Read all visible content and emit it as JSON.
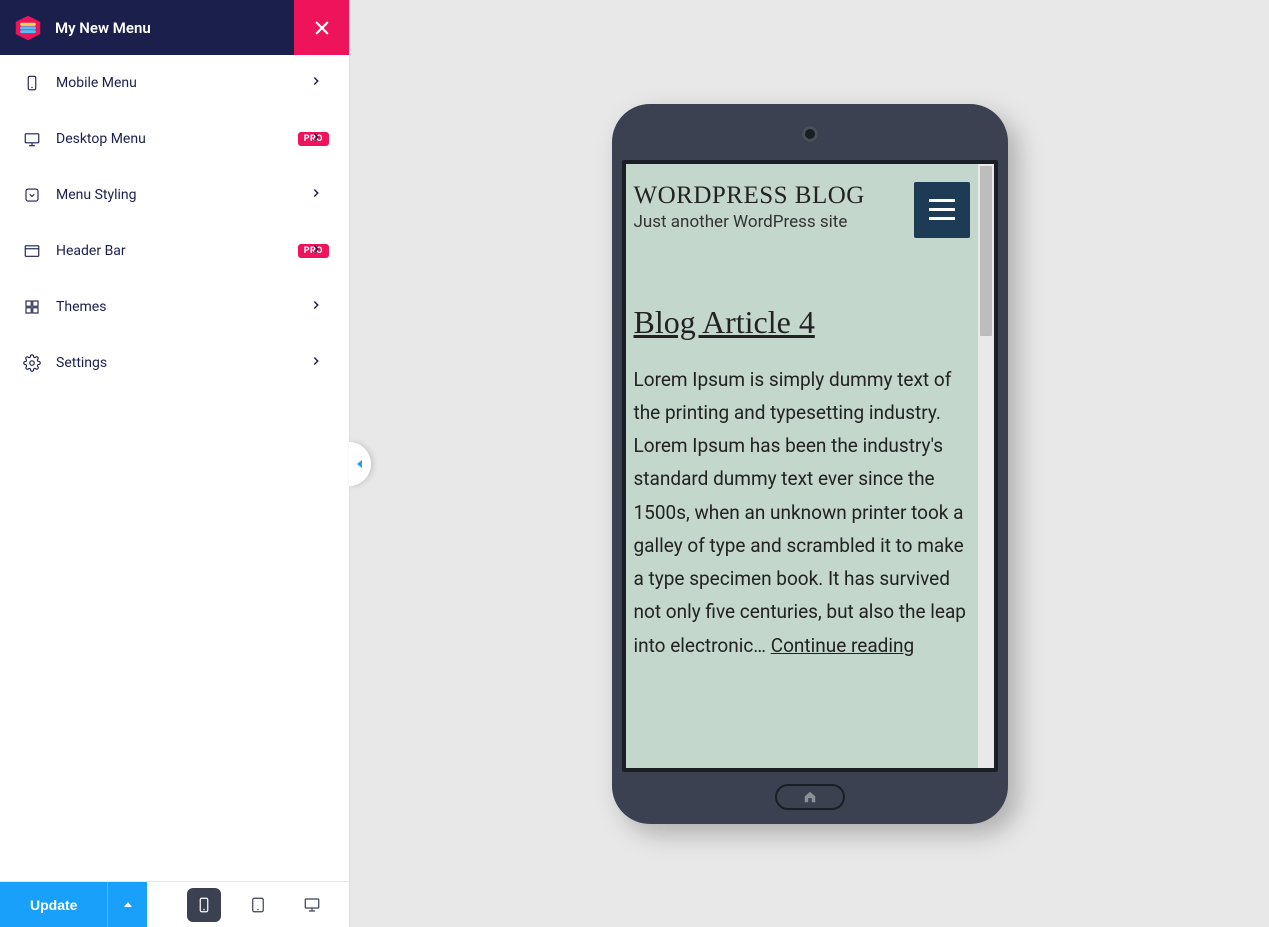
{
  "sidebar": {
    "title": "My New Menu",
    "items": [
      {
        "label": "Mobile Menu",
        "icon": "mobile",
        "pro": false
      },
      {
        "label": "Desktop Menu",
        "icon": "desktop",
        "pro": true
      },
      {
        "label": "Menu Styling",
        "icon": "chevbox",
        "pro": false
      },
      {
        "label": "Header Bar",
        "icon": "window",
        "pro": true
      },
      {
        "label": "Themes",
        "icon": "grid",
        "pro": false
      },
      {
        "label": "Settings",
        "icon": "gear",
        "pro": false
      }
    ],
    "pro_label": "PRO"
  },
  "footer": {
    "update_label": "Update",
    "devices": {
      "mobile_active": true
    }
  },
  "preview": {
    "site_title": "WORDPRESS BLOG",
    "site_tagline": "Just another WordPress site",
    "article": {
      "title": "Blog Article 4",
      "body": "Lorem Ipsum is simply dummy text of the printing and typesetting industry. Lorem Ipsum has been the industry's standard dummy text ever since the 1500s, when an unknown printer took a galley of type and scrambled it to make a type specimen book. It has survived not only five centuries, but also the leap into electronic… ",
      "read_more": "Continue reading"
    }
  }
}
